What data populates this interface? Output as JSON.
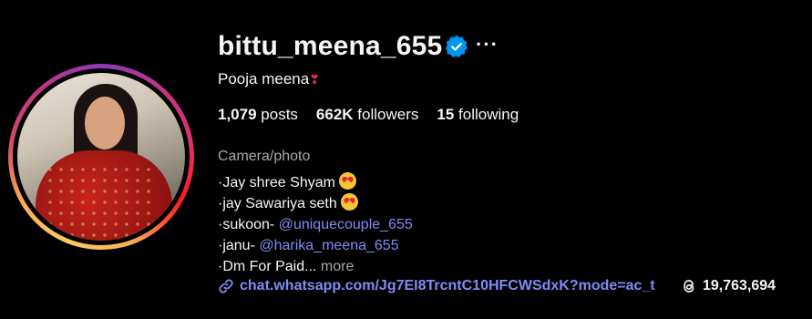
{
  "profile": {
    "username": "bittu_meena_655",
    "full_name": "Pooja meena",
    "full_name_emoji": "❣",
    "verified": true,
    "more_options": "···"
  },
  "stats": {
    "posts_count": "1,079",
    "posts_label": "posts",
    "followers_count": "662K",
    "followers_label": "followers",
    "following_count": "15",
    "following_label": "following"
  },
  "bio": {
    "category": "Camera/photo",
    "lines": [
      {
        "prefix": "·Jay shree Shyam"
      },
      {
        "prefix": "·jay Sawariya seth"
      },
      {
        "prefix": "·sukoon- ",
        "mention": "@uniquecouple_655"
      },
      {
        "prefix": "·janu- ",
        "mention": "@harika_meena_655"
      },
      {
        "prefix": "·Dm For Paid... ",
        "more": "more"
      }
    ]
  },
  "link": {
    "url_text": "chat.whatsapp.com/Jg7EI8TrcntC10HFCWSdxK?mode=ac_t"
  },
  "threads": {
    "count": "19,763,694"
  },
  "colors": {
    "background": "#000000",
    "text": "#f5f5f5",
    "secondary_text": "#a8a8a8",
    "link": "#7f8cf5",
    "verified_badge": "#0095f6"
  }
}
